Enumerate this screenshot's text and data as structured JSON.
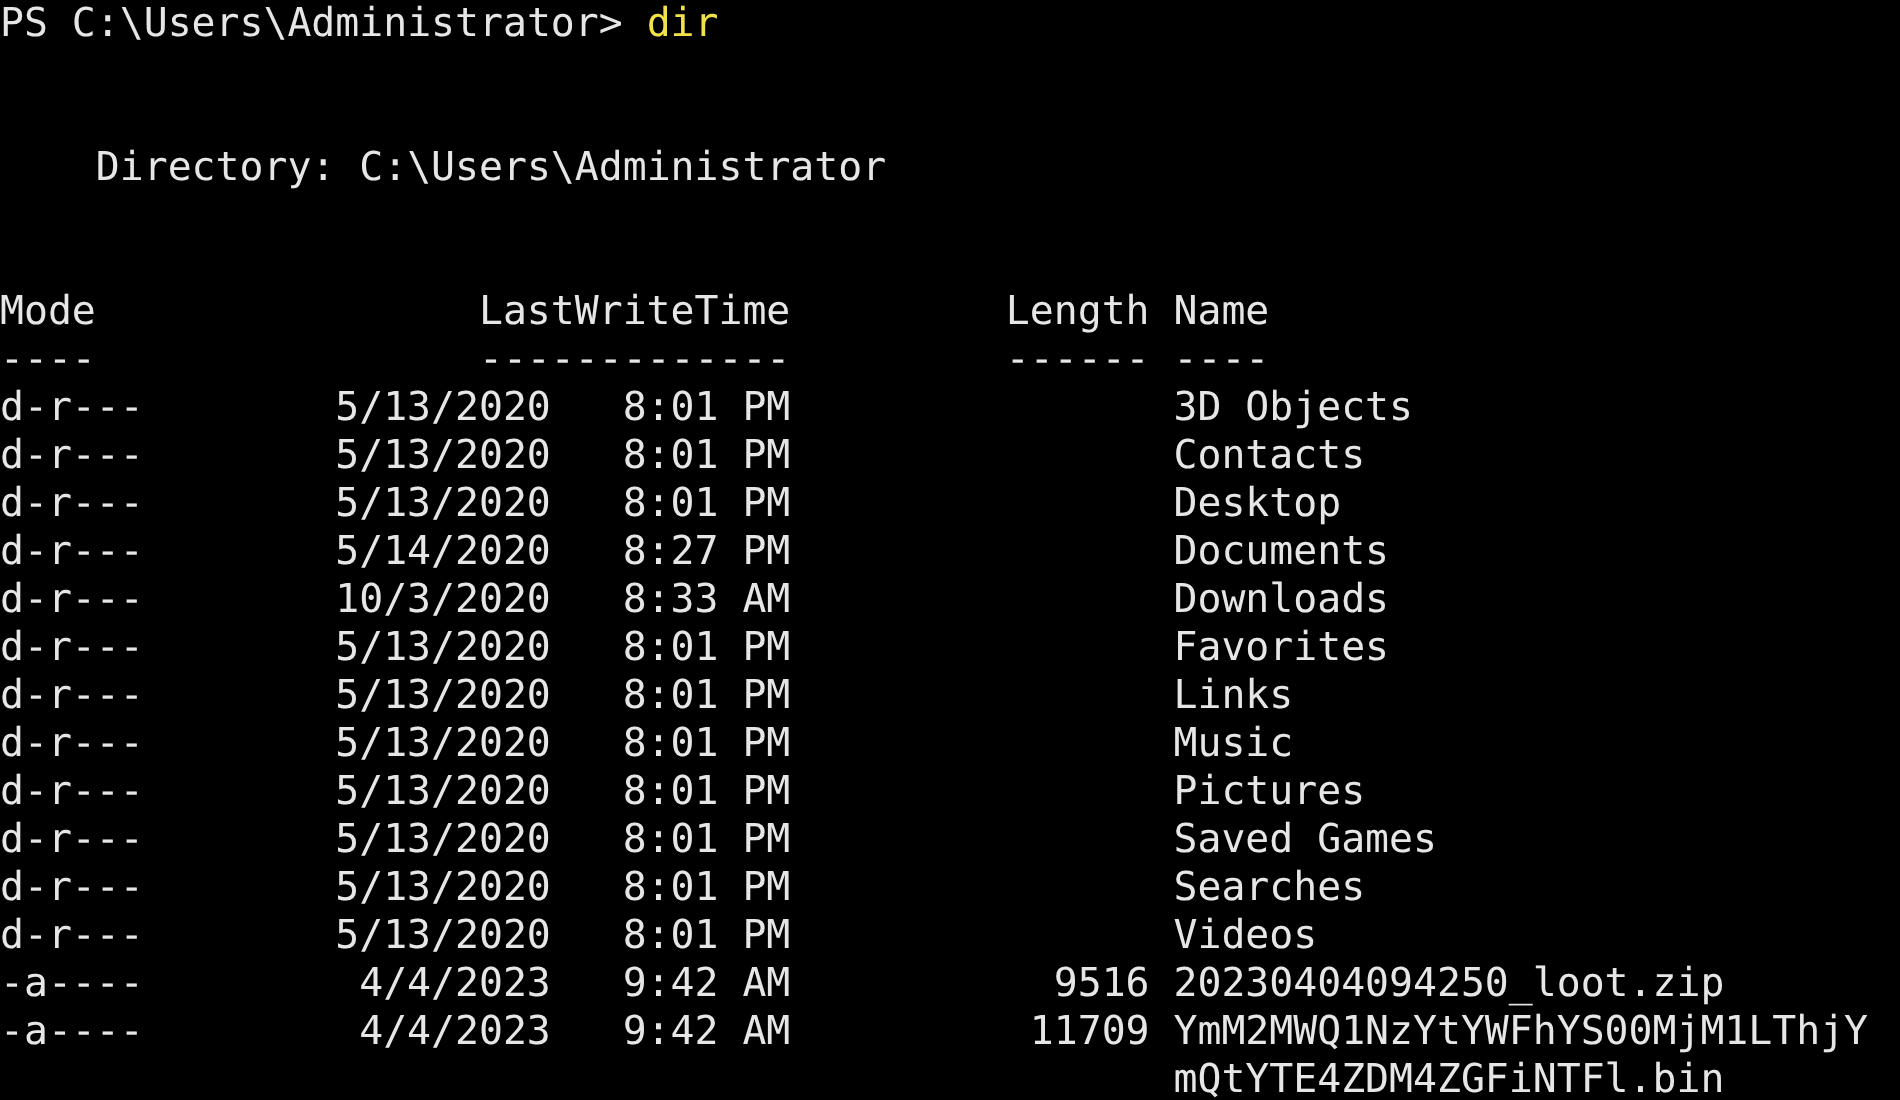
{
  "prompt": {
    "text": "PS C:\\Users\\Administrator>",
    "command": "dir"
  },
  "directory": "Directory: C:\\Users\\Administrator",
  "columns": [
    {
      "label": "Mode",
      "underline": "----"
    },
    {
      "label": "LastWriteTime",
      "underline": "-------------"
    },
    {
      "label": "Length",
      "underline": "------"
    },
    {
      "label": "Name",
      "underline": "----"
    }
  ],
  "rows": [
    {
      "mode": "d-r---",
      "date": "5/13/2020",
      "time": "8:01 PM",
      "name": "3D Objects"
    },
    {
      "mode": "d-r---",
      "date": "5/13/2020",
      "time": "8:01 PM",
      "name": "Contacts"
    },
    {
      "mode": "d-r---",
      "date": "5/13/2020",
      "time": "8:01 PM",
      "name": "Desktop"
    },
    {
      "mode": "d-r---",
      "date": "5/14/2020",
      "time": "8:27 PM",
      "name": "Documents"
    },
    {
      "mode": "d-r---",
      "date": "10/3/2020",
      "time": "8:33 AM",
      "name": "Downloads"
    },
    {
      "mode": "d-r---",
      "date": "5/13/2020",
      "time": "8:01 PM",
      "name": "Favorites"
    },
    {
      "mode": "d-r---",
      "date": "5/13/2020",
      "time": "8:01 PM",
      "name": "Links"
    },
    {
      "mode": "d-r---",
      "date": "5/13/2020",
      "time": "8:01 PM",
      "name": "Music"
    },
    {
      "mode": "d-r---",
      "date": "5/13/2020",
      "time": "8:01 PM",
      "name": "Pictures"
    },
    {
      "mode": "d-r---",
      "date": "5/13/2020",
      "time": "8:01 PM",
      "name": "Saved Games"
    },
    {
      "mode": "d-r---",
      "date": "5/13/2020",
      "time": "8:01 PM",
      "name": "Searches"
    },
    {
      "mode": "d-r---",
      "date": "5/13/2020",
      "time": "8:01 PM",
      "name": "Videos"
    },
    {
      "mode": "-a----",
      "date": "4/4/2023",
      "time": "9:42 AM",
      "length": "9516",
      "name": "20230404094250_loot.zip"
    },
    {
      "mode": "-a----",
      "date": "4/4/2023",
      "time": "9:42 AM",
      "length": "11709",
      "name": "YmM2MWQ1NzYtYWFhYS00MjM1LThjYmQtYTE4ZDM4ZGFiNTFl.bin"
    }
  ]
}
